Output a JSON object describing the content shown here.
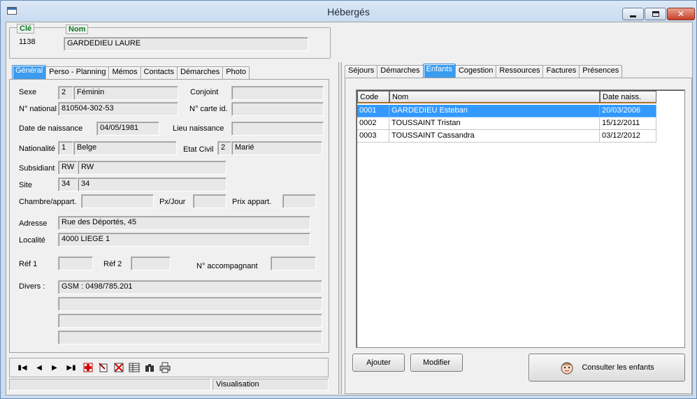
{
  "window": {
    "title": "Hébergés"
  },
  "header": {
    "key_label": "Clé",
    "key_value": "1138",
    "name_label": "Nom",
    "name_value": "GARDEDIEU LAURE"
  },
  "left_tabs": [
    "Général",
    "Perso - Planning",
    "Mémos",
    "Contacts",
    "Démarches",
    "Photo"
  ],
  "general": {
    "sexe_label": "Sexe",
    "sexe_code": "2",
    "sexe_value": "Féminin",
    "conjoint_label": "Conjoint",
    "conjoint_value": "",
    "national_label": "N° national",
    "national_value": "810504-302-53",
    "carte_label": "N° carte id.",
    "carte_value": "",
    "birth_label": "Date de naissance",
    "birth_value": "04/05/1981",
    "birthplace_label": "Lieu naissance",
    "birthplace_value": "",
    "nationalite_label": "Nationalité",
    "nationalite_code": "1",
    "nationalite_value": "Belge",
    "etatcivil_label": "Etat Civil",
    "etatcivil_code": "2",
    "etatcivil_value": "Marié",
    "subsidiant_label": "Subsidiant",
    "subsidiant_code": "RW",
    "subsidiant_value": "RW",
    "site_label": "Site",
    "site_code": "34",
    "site_value": "34",
    "chambre_label": "Chambre/appart.",
    "chambre_value": "",
    "pxjour_label": "Px/Jour",
    "pxjour_value": "",
    "prix_label": "Prix appart.",
    "prix_value": "",
    "adresse_label": "Adresse",
    "adresse_value": "Rue des Déportés, 45",
    "localite_label": "Localité",
    "localite_value": "4000 LIEGE 1",
    "ref1_label": "Réf 1",
    "ref1_value": "",
    "ref2_label": "Réf 2",
    "ref2_value": "",
    "accomp_label": "N°  accompagnant",
    "accomp_value": "",
    "divers_label": "Divers :",
    "divers_lines": [
      "GSM : 0498/785.201",
      "",
      "",
      ""
    ]
  },
  "right_tabs": [
    "Séjours",
    "Démarches",
    "Enfants",
    "Cogestion",
    "Ressources",
    "Factures",
    "Présences"
  ],
  "children": {
    "columns": [
      "Code",
      "Nom",
      "Date naiss."
    ],
    "rows": [
      [
        "0001",
        "GARDEDIEU Esteban",
        "20/03/2006"
      ],
      [
        "0002",
        "TOUSSAINT Tristan",
        "15/12/2011"
      ],
      [
        "0003",
        "TOUSSAINT Cassandra",
        "03/12/2012"
      ]
    ]
  },
  "buttons": {
    "ajouter": "Ajouter",
    "modifier": "Modifier",
    "consulter": "Consulter les enfants"
  },
  "status": {
    "left": "",
    "mode": "Visualisation"
  },
  "colors": {
    "accent": "#3399ff",
    "legend_green": "#0a7a1d"
  }
}
